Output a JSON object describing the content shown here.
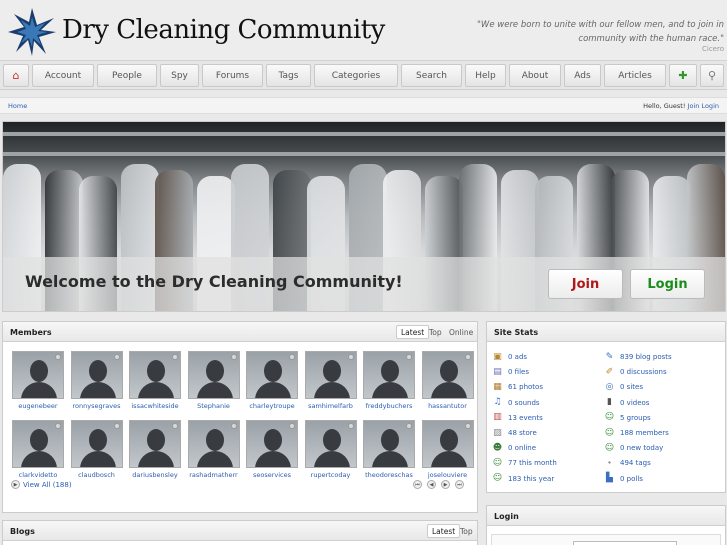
{
  "site": {
    "title": "Dry Cleaning Community",
    "quote": "\"We were born to unite with our fellow men, and to join in community with the human race.\"",
    "quote_author": "Cicero",
    "logo_icon": "star-logo-icon",
    "brand_color": "#1a3d6e"
  },
  "nav": {
    "home_icon": "home-icon",
    "items": [
      "Account",
      "People",
      "Spy",
      "Forums",
      "Tags",
      "Categories",
      "Search",
      "Help",
      "About",
      "Ads",
      "Articles"
    ],
    "add_icon": "add-icon",
    "search_icon": "magnifier-icon"
  },
  "breadcrumb": {
    "home": "Home",
    "greeting": "Hello, Guest!",
    "join": "Join",
    "login": "Login"
  },
  "hero": {
    "headline": "Welcome to the Dry Cleaning Community!",
    "join_label": "Join",
    "login_label": "Login"
  },
  "members": {
    "title": "Members",
    "tabs": [
      "Latest",
      "Top",
      "Online"
    ],
    "active_tab": "Latest",
    "names": [
      "eugenebeer",
      "ronnysegraves",
      "issacwhiteside",
      "Stephanie",
      "charleytroupe",
      "samhimelfarb",
      "freddybuchers",
      "hassantutor",
      "clarkvidetto",
      "claudbosch",
      "dariusbensley",
      "rashadmatherr",
      "seoservices",
      "rupertcoday",
      "theodoreschas",
      "joselouviere"
    ],
    "view_all": "View All (188)",
    "pager_icons": [
      "first-page-icon",
      "previous-page-icon",
      "next-page-icon",
      "last-page-icon"
    ]
  },
  "blogs": {
    "title": "Blogs",
    "tabs": [
      "Latest",
      "Top"
    ]
  },
  "site_stats": {
    "title": "Site Stats",
    "left": [
      {
        "text": "0 ads",
        "icon": "ads-icon"
      },
      {
        "text": "0 files",
        "icon": "files-icon"
      },
      {
        "text": "61 photos",
        "icon": "photos-icon"
      },
      {
        "text": "0 sounds",
        "icon": "sounds-icon"
      },
      {
        "text": "13 events",
        "icon": "events-icon"
      },
      {
        "text": "48 store",
        "icon": "store-icon"
      },
      {
        "text": "0 online",
        "icon": "online-icon"
      },
      {
        "text": "77 this month",
        "icon": "this-month-icon"
      },
      {
        "text": "183 this year",
        "icon": "this-year-icon"
      }
    ],
    "right": [
      {
        "text": "839 blog posts",
        "icon": "blog-posts-icon"
      },
      {
        "text": "0 discussions",
        "icon": "discussions-icon"
      },
      {
        "text": "0 sites",
        "icon": "sites-icon"
      },
      {
        "text": "0 videos",
        "icon": "videos-icon"
      },
      {
        "text": "5 groups",
        "icon": "groups-icon"
      },
      {
        "text": "188 members",
        "icon": "members-icon"
      },
      {
        "text": "0 new today",
        "icon": "new-today-icon"
      },
      {
        "text": "494 tags",
        "icon": "tags-icon"
      },
      {
        "text": "0 polls",
        "icon": "polls-icon"
      }
    ]
  },
  "login_panel": {
    "title": "Login"
  }
}
